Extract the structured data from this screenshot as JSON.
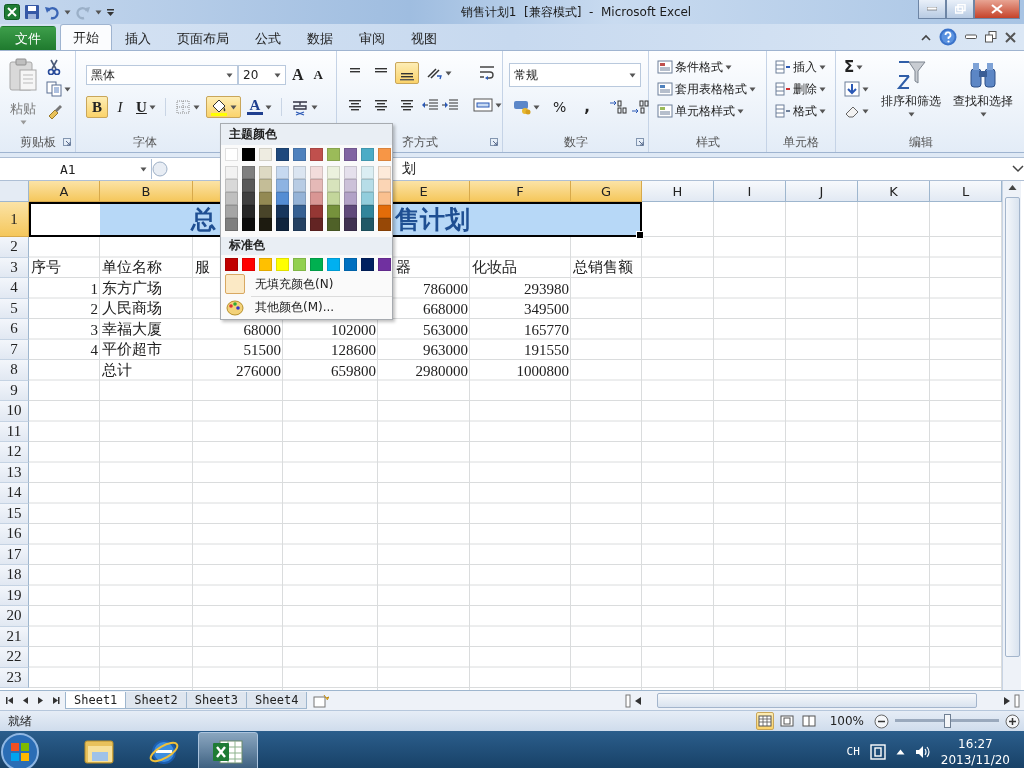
{
  "title_bar": {
    "title": "销售计划1  [兼容模式]  -  Microsoft Excel"
  },
  "ribbon_tabs": [
    {
      "label": "文件",
      "kind": "file",
      "selected": false
    },
    {
      "label": "开始",
      "kind": "tab",
      "selected": true
    },
    {
      "label": "插入",
      "kind": "tab",
      "selected": false
    },
    {
      "label": "页面布局",
      "kind": "tab",
      "selected": false
    },
    {
      "label": "公式",
      "kind": "tab",
      "selected": false
    },
    {
      "label": "数据",
      "kind": "tab",
      "selected": false
    },
    {
      "label": "审阅",
      "kind": "tab",
      "selected": false
    },
    {
      "label": "视图",
      "kind": "tab",
      "selected": false
    }
  ],
  "ribbon": {
    "clipboard": {
      "paste": "粘贴",
      "label": "剪贴板"
    },
    "font": {
      "name": "黑体",
      "size": "20",
      "grow": "A",
      "shrink": "A",
      "bold_label": "B",
      "italic_label": "I",
      "underline_label": "U",
      "color_label": "A",
      "bold": true,
      "fill_open": true,
      "label": "字体"
    },
    "alignment": {
      "bottom_align": true,
      "label": "齐方式"
    },
    "number": {
      "format": "常规",
      "percent": "%",
      "comma": ",",
      "label": "数字"
    },
    "styles": {
      "items": [
        "条件格式",
        "套用表格格式",
        "单元格样式"
      ],
      "label": "样式"
    },
    "cells": {
      "items": [
        "插入",
        "删除",
        "格式"
      ],
      "label": "单元格"
    },
    "editing": {
      "sum": "Σ",
      "sort": "排序和筛选",
      "find": "查找和选择",
      "label": "编辑"
    }
  },
  "formula_bar": {
    "name_box": "A1",
    "value": "划"
  },
  "sheet": {
    "columns": [
      {
        "label": "A",
        "selected": true
      },
      {
        "label": "B",
        "selected": true
      },
      {
        "selected": true
      },
      {
        "label": "E",
        "selected": true
      },
      {
        "label": "F",
        "selected": true
      },
      {
        "label": "G",
        "selected": true
      },
      {
        "label": "H",
        "selected": false
      },
      {
        "label": "I",
        "selected": false
      },
      {
        "label": "J",
        "selected": false
      },
      {
        "label": "K",
        "selected": false
      },
      {
        "label": "L",
        "selected": false
      }
    ],
    "title": [
      "总",
      "售计划"
    ],
    "rows": [
      {
        "label": "1",
        "selected": true,
        "kind": "title"
      },
      {
        "label": "2",
        "selected": false
      },
      {
        "label": "3",
        "selected": false,
        "cells": [
          {
            "kind": "text",
            "text": "序号"
          },
          {
            "kind": "text",
            "text": "单位名称"
          },
          {
            "kind": "text",
            "text": "服"
          },
          {
            "kind": "empty"
          },
          {
            "kind": "partial",
            "text": "器"
          },
          {
            "kind": "text",
            "text": "化妆品"
          },
          {
            "kind": "text",
            "text": "总销售额"
          }
        ]
      },
      {
        "label": "4",
        "selected": false,
        "cells": [
          {
            "kind": "number",
            "text": "1"
          },
          {
            "kind": "text",
            "text": "东方广场"
          },
          {
            "kind": "empty"
          },
          {
            "kind": "empty"
          },
          {
            "kind": "number",
            "text": "786000"
          },
          {
            "kind": "number",
            "text": "293980"
          }
        ]
      },
      {
        "label": "5",
        "selected": false,
        "cells": [
          {
            "kind": "number",
            "text": "2"
          },
          {
            "kind": "text",
            "text": "人民商场"
          },
          {
            "kind": "empty"
          },
          {
            "kind": "empty"
          },
          {
            "kind": "number",
            "text": "668000"
          },
          {
            "kind": "number",
            "text": "349500"
          }
        ]
      },
      {
        "label": "6",
        "selected": false,
        "cells": [
          {
            "kind": "number",
            "text": "3"
          },
          {
            "kind": "text",
            "text": "幸福大厦"
          },
          {
            "kind": "number",
            "text": "68000"
          },
          {
            "kind": "number",
            "text": "102000"
          },
          {
            "kind": "number",
            "text": "563000"
          },
          {
            "kind": "number",
            "text": "165770"
          }
        ]
      },
      {
        "label": "7",
        "selected": false,
        "cells": [
          {
            "kind": "number",
            "text": "4"
          },
          {
            "kind": "text",
            "text": "平价超市"
          },
          {
            "kind": "number",
            "text": "51500"
          },
          {
            "kind": "number",
            "text": "128600"
          },
          {
            "kind": "number",
            "text": "963000"
          },
          {
            "kind": "number",
            "text": "191550"
          }
        ]
      },
      {
        "label": "8",
        "selected": false,
        "cells": [
          {
            "kind": "empty"
          },
          {
            "kind": "text",
            "text": "总计"
          },
          {
            "kind": "number",
            "text": "276000"
          },
          {
            "kind": "number",
            "text": "659800"
          },
          {
            "kind": "number",
            "text": "2980000"
          },
          {
            "kind": "number",
            "text": "1000800"
          }
        ]
      },
      {
        "label": "9",
        "selected": false
      },
      {
        "label": "10",
        "selected": false
      },
      {
        "label": "11",
        "selected": false
      },
      {
        "label": "12",
        "selected": false
      },
      {
        "label": "13",
        "selected": false
      },
      {
        "label": "14",
        "selected": false
      },
      {
        "label": "15",
        "selected": false
      },
      {
        "label": "16",
        "selected": false
      },
      {
        "label": "17",
        "selected": false
      },
      {
        "label": "18",
        "selected": false
      },
      {
        "label": "19",
        "selected": false
      },
      {
        "label": "20",
        "selected": false
      },
      {
        "label": "21",
        "selected": false
      },
      {
        "label": "22",
        "selected": false
      },
      {
        "label": "23",
        "selected": false
      }
    ]
  },
  "fill_color_menu": {
    "theme_title": "主题颜色",
    "theme_colors": [
      {
        "color": "#ffffff"
      },
      {
        "color": "#000000"
      },
      {
        "color": "#eeece1"
      },
      {
        "color": "#1f497d"
      },
      {
        "color": "#4f81bd"
      },
      {
        "color": "#c0504d"
      },
      {
        "color": "#9bbb59"
      },
      {
        "color": "#8064a2"
      },
      {
        "color": "#4bacc6"
      },
      {
        "color": "#f79646"
      }
    ],
    "shade_rows": [
      {
        "swatches": [
          {
            "color": "#f2f2f2"
          },
          {
            "color": "#7f7f7f"
          },
          {
            "color": "#ddd9c3"
          },
          {
            "color": "#c6d9f0"
          },
          {
            "color": "#dbe5f1"
          },
          {
            "color": "#f2dcdb"
          },
          {
            "color": "#ebf1dd"
          },
          {
            "color": "#e5e0ec"
          },
          {
            "color": "#dbeef3"
          },
          {
            "color": "#fdeada"
          }
        ]
      },
      {
        "swatches": [
          {
            "color": "#d8d8d8"
          },
          {
            "color": "#595959"
          },
          {
            "color": "#c4bd97"
          },
          {
            "color": "#8db3e2"
          },
          {
            "color": "#b8cce4"
          },
          {
            "color": "#e5b9b7"
          },
          {
            "color": "#d7e3bc"
          },
          {
            "color": "#ccc1d9"
          },
          {
            "color": "#b7dde8"
          },
          {
            "color": "#fbd5b5"
          }
        ]
      },
      {
        "swatches": [
          {
            "color": "#bfbfbf"
          },
          {
            "color": "#3f3f3f"
          },
          {
            "color": "#938953"
          },
          {
            "color": "#548dd4"
          },
          {
            "color": "#95b3d7"
          },
          {
            "color": "#d99694"
          },
          {
            "color": "#c3d69b"
          },
          {
            "color": "#b2a2c7"
          },
          {
            "color": "#92cddc"
          },
          {
            "color": "#fac08f"
          }
        ]
      },
      {
        "swatches": [
          {
            "color": "#a5a5a5"
          },
          {
            "color": "#262626"
          },
          {
            "color": "#494429"
          },
          {
            "color": "#17365d"
          },
          {
            "color": "#366092"
          },
          {
            "color": "#953734"
          },
          {
            "color": "#76923c"
          },
          {
            "color": "#5f497a"
          },
          {
            "color": "#31859b"
          },
          {
            "color": "#e36c09"
          }
        ]
      },
      {
        "swatches": [
          {
            "color": "#7f7f7f"
          },
          {
            "color": "#0c0c0c"
          },
          {
            "color": "#1d1b10"
          },
          {
            "color": "#0f243e"
          },
          {
            "color": "#244061"
          },
          {
            "color": "#632423"
          },
          {
            "color": "#4f6128"
          },
          {
            "color": "#3f3151"
          },
          {
            "color": "#205867"
          },
          {
            "color": "#974806"
          }
        ]
      }
    ],
    "standard_title": "标准色",
    "standard_colors": [
      {
        "color": "#c00000"
      },
      {
        "color": "#ff0000"
      },
      {
        "color": "#ffc000"
      },
      {
        "color": "#ffff00"
      },
      {
        "color": "#92d050"
      },
      {
        "color": "#00b050"
      },
      {
        "color": "#00b0f0"
      },
      {
        "color": "#0070c0"
      },
      {
        "color": "#002060"
      },
      {
        "color": "#7030a0"
      }
    ],
    "no_fill": "无填充颜色(N)",
    "more_colors": "其他颜色(M)..."
  },
  "sheet_tabs": [
    {
      "label": "Sheet1",
      "selected": true
    },
    {
      "label": "Sheet2",
      "selected": false
    },
    {
      "label": "Sheet3",
      "selected": false
    },
    {
      "label": "Sheet4",
      "selected": false
    }
  ],
  "status_bar": {
    "text": "就绪",
    "views": [
      {
        "kind": "normal",
        "selected": true
      },
      {
        "kind": "page_layout",
        "selected": false
      },
      {
        "kind": "page_break",
        "selected": false
      }
    ],
    "zoom": "100%",
    "zoom_slider": {
      "level": 0.5
    }
  },
  "taskbar": {
    "apps": [
      {
        "kind": "explorer",
        "selected": false
      },
      {
        "kind": "browser",
        "selected": false
      },
      {
        "kind": "excel",
        "selected": true
      }
    ],
    "language": "CH",
    "time": "16:27",
    "date": "2013/11/20"
  }
}
